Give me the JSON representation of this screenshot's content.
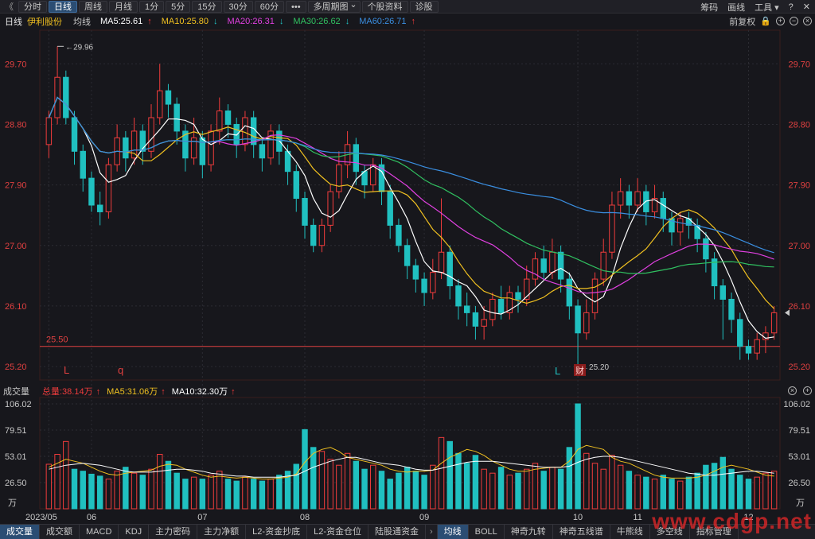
{
  "toolbar": {
    "back_icon": "double-chevron-left-icon",
    "tabs": [
      "分时",
      "日线",
      "周线",
      "月线",
      "1分",
      "5分",
      "15分",
      "30分",
      "60分",
      "•••",
      "多周期图",
      "个股资料",
      "诊股"
    ],
    "active_tab": 1,
    "right_links": [
      "筹码",
      "画线",
      "工具"
    ],
    "help_icon": "help-icon",
    "close_icon": "close-icon"
  },
  "ma_row": {
    "period": "日线",
    "stock_name": "伊利股份",
    "line_type": "均线",
    "ma5": "MA5:25.61",
    "ma10": "MA10:25.80",
    "ma20": "MA20:26.31",
    "ma30": "MA30:26.62",
    "ma60": "MA60:26.71",
    "ma5_arrow": "↑",
    "ma10_arrow": "↓",
    "ma20_arrow": "↓",
    "ma30_arrow": "↓",
    "ma60_arrow": "↑",
    "adjust": "前复权",
    "colors": {
      "ma5": "#ffffff",
      "ma10": "#f0c020",
      "ma20": "#e040e0",
      "ma30": "#30c060",
      "ma60": "#3a8ee0",
      "up": "#f03c3c",
      "down": "#20c0c0"
    }
  },
  "vol_row": {
    "label": "成交量",
    "total": "总量:38.14万",
    "ma5": "MA5:31.06万",
    "ma10": "MA10:32.30万",
    "arrow": "↑"
  },
  "price_axis": {
    "ticks": [
      "29.70",
      "28.80",
      "27.90",
      "27.00",
      "26.10",
      "25.20"
    ],
    "high_label": "29.96",
    "low_label": "25.20",
    "hline_label": "25.50"
  },
  "volume_axis": {
    "ticks": [
      "106.02",
      "79.51",
      "53.01",
      "26.50"
    ],
    "unit": "万"
  },
  "markers": {
    "l1": "L",
    "q": "q",
    "l2": "L",
    "cai": "财"
  },
  "date_axis": [
    "2023/05",
    "06",
    "07",
    "08",
    "09",
    "10",
    "11",
    "12"
  ],
  "bottom_tabs": [
    "成交量",
    "成交额",
    "MACD",
    "KDJ",
    "主力密码",
    "主力净额",
    "L2-资金抄底",
    "L2-资金仓位",
    "陆股通资金",
    "›",
    "均线",
    "BOLL",
    "神奇九转",
    "神奇五线谱",
    "牛熊线",
    "多空线",
    "指标管理"
  ],
  "bottom_active": [
    0,
    10
  ],
  "watermark": "www.cdgp.net",
  "chart_data": {
    "type": "candlestick",
    "title": "伊利股份",
    "price_range": [
      25.0,
      30.2
    ],
    "volume_range": [
      0,
      106.02
    ],
    "hline": 25.5,
    "high": 29.96,
    "low": 25.2,
    "x_months": [
      "2023/05",
      "06",
      "07",
      "08",
      "09",
      "10",
      "11",
      "12"
    ],
    "candles": [
      [
        28.5,
        28.9,
        28.3,
        29.0
      ],
      [
        28.9,
        29.5,
        28.8,
        29.96
      ],
      [
        29.5,
        28.9,
        28.8,
        29.6
      ],
      [
        28.9,
        28.4,
        28.2,
        29.0
      ],
      [
        28.4,
        28.0,
        27.8,
        28.5
      ],
      [
        28.0,
        27.6,
        27.5,
        28.1
      ],
      [
        27.6,
        27.5,
        27.3,
        27.8
      ],
      [
        27.5,
        28.2,
        27.4,
        28.3
      ],
      [
        28.2,
        28.6,
        28.1,
        28.8
      ],
      [
        28.6,
        28.3,
        28.1,
        28.7
      ],
      [
        28.3,
        28.7,
        28.2,
        28.9
      ],
      [
        28.7,
        28.4,
        28.2,
        28.8
      ],
      [
        28.4,
        28.9,
        28.3,
        29.1
      ],
      [
        28.9,
        29.3,
        28.8,
        29.7
      ],
      [
        29.3,
        29.1,
        28.9,
        29.4
      ],
      [
        29.1,
        28.7,
        28.5,
        29.2
      ],
      [
        28.7,
        28.3,
        28.1,
        28.8
      ],
      [
        28.3,
        28.6,
        28.2,
        28.9
      ],
      [
        28.6,
        28.2,
        28.0,
        28.7
      ],
      [
        28.2,
        28.7,
        28.1,
        28.8
      ],
      [
        28.7,
        29.0,
        28.5,
        29.2
      ],
      [
        29.0,
        28.8,
        28.6,
        29.1
      ],
      [
        28.8,
        28.5,
        28.3,
        28.9
      ],
      [
        28.5,
        28.9,
        28.4,
        29.0
      ],
      [
        28.9,
        28.5,
        28.3,
        29.0
      ],
      [
        28.5,
        28.3,
        28.1,
        28.6
      ],
      [
        28.3,
        28.7,
        28.2,
        28.8
      ],
      [
        28.7,
        28.4,
        28.2,
        28.8
      ],
      [
        28.4,
        28.1,
        27.9,
        28.5
      ],
      [
        28.1,
        27.7,
        27.5,
        28.2
      ],
      [
        27.7,
        27.3,
        27.1,
        27.8
      ],
      [
        27.3,
        27.0,
        26.9,
        27.4
      ],
      [
        27.0,
        27.3,
        26.9,
        27.4
      ],
      [
        27.3,
        27.8,
        27.2,
        27.9
      ],
      [
        27.8,
        28.2,
        27.7,
        28.4
      ],
      [
        28.2,
        28.5,
        28.0,
        28.7
      ],
      [
        28.5,
        28.1,
        27.9,
        28.6
      ],
      [
        28.1,
        27.9,
        27.7,
        28.2
      ],
      [
        27.9,
        28.2,
        27.8,
        28.3
      ],
      [
        28.2,
        27.8,
        27.6,
        28.3
      ],
      [
        27.8,
        27.3,
        27.1,
        27.9
      ],
      [
        27.3,
        27.0,
        26.9,
        27.4
      ],
      [
        27.0,
        26.7,
        26.5,
        27.1
      ],
      [
        26.7,
        26.5,
        26.3,
        26.8
      ],
      [
        26.5,
        26.3,
        26.1,
        26.6
      ],
      [
        26.3,
        26.6,
        26.2,
        26.8
      ],
      [
        26.6,
        26.9,
        26.5,
        27.7
      ],
      [
        26.9,
        26.4,
        26.2,
        27.0
      ],
      [
        26.4,
        26.1,
        25.9,
        26.5
      ],
      [
        26.1,
        26.0,
        25.8,
        26.3
      ],
      [
        26.0,
        25.8,
        25.6,
        26.1
      ],
      [
        25.8,
        25.9,
        25.6,
        26.1
      ],
      [
        25.9,
        26.2,
        25.8,
        26.3
      ],
      [
        26.2,
        26.0,
        25.9,
        26.4
      ],
      [
        26.0,
        26.3,
        25.9,
        26.4
      ],
      [
        26.3,
        26.2,
        26.0,
        26.4
      ],
      [
        26.2,
        26.5,
        26.1,
        26.7
      ],
      [
        26.5,
        26.8,
        26.4,
        26.9
      ],
      [
        26.8,
        26.6,
        26.5,
        27.0
      ],
      [
        26.6,
        26.9,
        26.5,
        27.1
      ],
      [
        26.9,
        26.5,
        26.3,
        27.0
      ],
      [
        26.5,
        26.1,
        25.9,
        26.6
      ],
      [
        26.1,
        25.7,
        25.2,
        26.2
      ],
      [
        25.7,
        26.0,
        25.6,
        26.2
      ],
      [
        26.0,
        26.5,
        25.9,
        26.6
      ],
      [
        26.5,
        26.9,
        26.4,
        27.1
      ],
      [
        26.9,
        27.6,
        26.8,
        27.8
      ],
      [
        27.6,
        27.8,
        27.4,
        28.0
      ],
      [
        27.8,
        27.6,
        27.4,
        27.9
      ],
      [
        27.6,
        27.8,
        27.5,
        28.0
      ],
      [
        27.8,
        27.5,
        27.3,
        27.9
      ],
      [
        27.5,
        27.7,
        27.4,
        27.9
      ],
      [
        27.7,
        27.4,
        27.2,
        27.8
      ],
      [
        27.4,
        27.2,
        27.0,
        27.5
      ],
      [
        27.2,
        27.4,
        27.0,
        27.5
      ],
      [
        27.4,
        27.3,
        27.1,
        27.5
      ],
      [
        27.3,
        27.1,
        26.9,
        27.4
      ],
      [
        27.1,
        26.8,
        26.6,
        27.2
      ],
      [
        26.8,
        26.4,
        26.2,
        26.9
      ],
      [
        26.4,
        26.2,
        25.6,
        26.5
      ],
      [
        26.2,
        25.9,
        25.7,
        26.3
      ],
      [
        25.9,
        25.5,
        25.3,
        26.0
      ],
      [
        25.5,
        25.4,
        25.3,
        25.6
      ],
      [
        25.4,
        25.6,
        25.3,
        25.7
      ],
      [
        25.6,
        25.7,
        25.4,
        25.8
      ],
      [
        25.7,
        26.0,
        25.6,
        26.1
      ]
    ],
    "volumes": [
      45,
      55,
      68,
      40,
      38,
      35,
      33,
      30,
      38,
      42,
      36,
      34,
      40,
      55,
      48,
      36,
      30,
      32,
      30,
      34,
      38,
      30,
      28,
      32,
      30,
      28,
      30,
      34,
      38,
      45,
      80,
      62,
      58,
      50,
      44,
      56,
      48,
      40,
      44,
      38,
      30,
      36,
      42,
      38,
      34,
      44,
      72,
      68,
      56,
      46,
      54,
      40,
      36,
      42,
      34,
      36,
      40,
      46,
      38,
      42,
      40,
      62,
      106.02,
      56,
      46,
      40,
      54,
      44,
      38,
      34,
      32,
      30,
      34,
      30,
      28,
      32,
      36,
      44,
      46,
      52,
      40,
      34,
      30,
      32,
      36,
      38
    ],
    "volume_up": [
      true,
      true,
      true,
      false,
      false,
      false,
      false,
      true,
      true,
      false,
      true,
      false,
      true,
      true,
      false,
      false,
      false,
      true,
      false,
      true,
      true,
      false,
      false,
      true,
      false,
      false,
      true,
      false,
      false,
      false,
      false,
      false,
      true,
      true,
      true,
      true,
      false,
      false,
      true,
      false,
      false,
      false,
      false,
      false,
      false,
      true,
      true,
      false,
      false,
      false,
      false,
      true,
      true,
      false,
      true,
      false,
      true,
      true,
      false,
      true,
      false,
      false,
      false,
      true,
      true,
      true,
      true,
      true,
      false,
      true,
      false,
      true,
      false,
      false,
      true,
      false,
      false,
      false,
      false,
      false,
      false,
      false,
      false,
      true,
      true,
      true
    ],
    "vol_ma5": [
      42,
      46,
      50,
      48,
      46,
      42,
      38,
      35,
      34,
      36,
      37,
      38,
      39,
      43,
      45,
      44,
      40,
      37,
      34,
      32,
      33,
      32,
      31,
      32,
      31,
      30,
      30,
      31,
      32,
      35,
      47,
      56,
      60,
      62,
      58,
      52,
      50,
      48,
      46,
      44,
      40,
      38,
      37,
      38,
      38,
      39,
      46,
      52,
      56,
      60,
      58,
      54,
      48,
      44,
      40,
      38,
      38,
      40,
      41,
      42,
      42,
      48,
      60,
      64,
      62,
      60,
      52,
      48,
      46,
      42,
      38,
      34,
      32,
      31,
      31,
      31,
      32,
      34,
      38,
      42,
      44,
      42,
      40,
      37,
      34,
      33
    ],
    "vol_ma10": [
      40,
      42,
      44,
      45,
      46,
      45,
      44,
      42,
      40,
      38,
      37,
      37,
      37,
      38,
      39,
      40,
      40,
      39,
      38,
      36,
      35,
      34,
      33,
      33,
      32,
      32,
      32,
      32,
      33,
      34,
      38,
      42,
      45,
      48,
      50,
      52,
      52,
      50,
      48,
      46,
      45,
      44,
      42,
      40,
      39,
      39,
      41,
      43,
      45,
      47,
      48,
      48,
      48,
      47,
      46,
      45,
      44,
      43,
      42,
      42,
      42,
      43,
      47,
      50,
      52,
      53,
      53,
      52,
      50,
      48,
      46,
      44,
      42,
      40,
      38,
      36,
      35,
      34,
      34,
      35,
      36,
      37,
      38,
      38,
      37,
      36
    ]
  }
}
